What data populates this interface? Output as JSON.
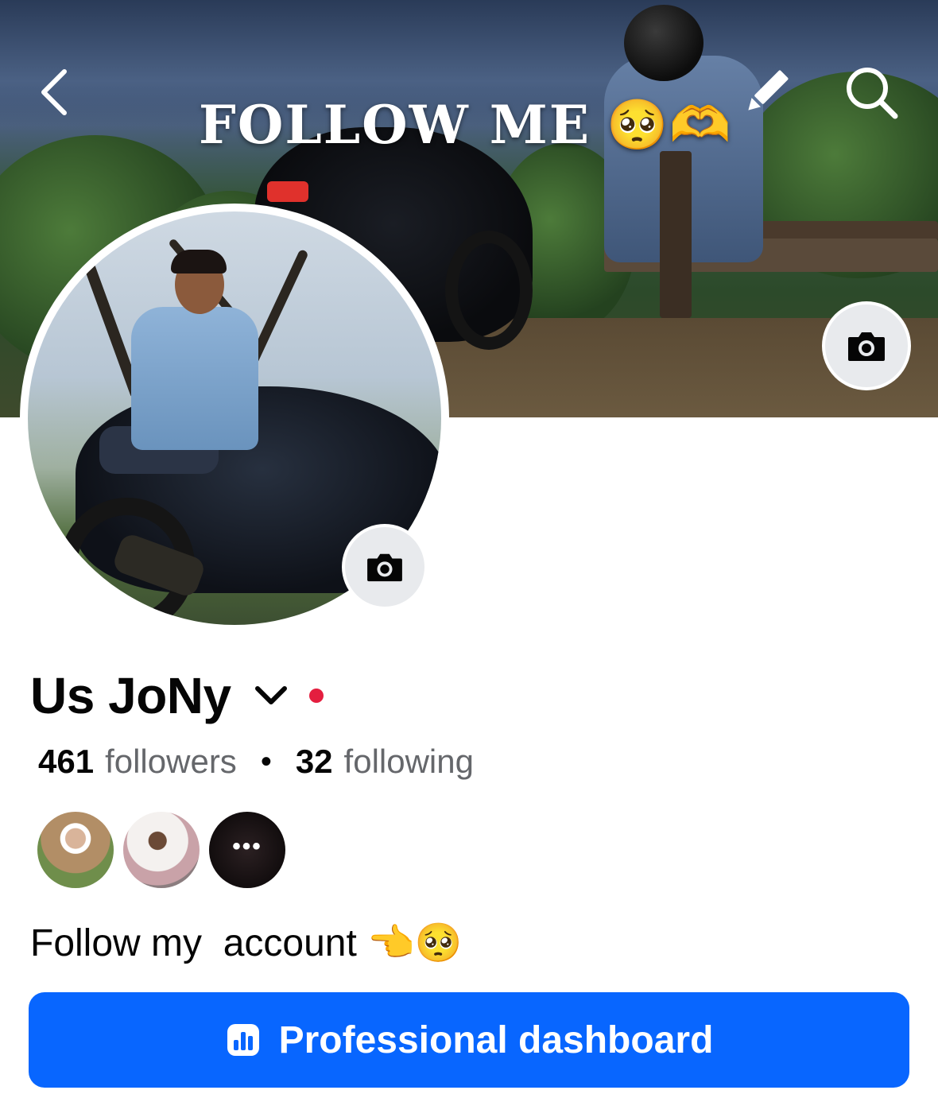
{
  "cover": {
    "title": "FOLLOW ME",
    "title_emojis": "🥺🫶",
    "back_icon": "chevron-left-icon",
    "edit_icon": "pencil-icon",
    "search_icon": "search-icon",
    "camera_icon": "camera-icon"
  },
  "profile": {
    "name": "Us JoNy",
    "name_dropdown_icon": "chevron-down-icon",
    "status_dot_color": "#e41e3f",
    "followers_count": "461",
    "followers_label": "followers",
    "separator": "•",
    "following_count": "32",
    "following_label": "following",
    "friends_more": "•••",
    "bio": "Follow my  account 👈🥺"
  },
  "actions": {
    "dashboard_label": "Professional dashboard",
    "dashboard_icon": "bar-chart-icon",
    "accent_color": "#0866ff"
  }
}
